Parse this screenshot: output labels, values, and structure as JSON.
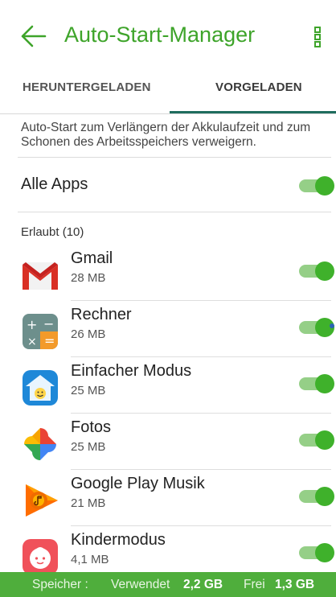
{
  "header": {
    "title": "Auto-Start-Manager"
  },
  "tabs": [
    {
      "label": "HERUNTERGELADEN",
      "selected": false
    },
    {
      "label": "VORGELADEN",
      "selected": true
    }
  ],
  "description": "Auto-Start zum Verlängern der Akkulaufzeit und zum Schonen des Arbeitsspeichers verweigern.",
  "all_apps": {
    "label": "Alle Apps",
    "enabled": true
  },
  "section": {
    "label": "Erlaubt (10)"
  },
  "apps": [
    {
      "name": "Gmail",
      "size": "28 MB",
      "icon": "gmail-icon",
      "enabled": true
    },
    {
      "name": "Rechner",
      "size": "26 MB",
      "icon": "calculator-icon",
      "enabled": true
    },
    {
      "name": "Einfacher Modus",
      "size": "25 MB",
      "icon": "easy-mode-icon",
      "enabled": true
    },
    {
      "name": "Fotos",
      "size": "25 MB",
      "icon": "photos-pinwheel-icon",
      "enabled": true
    },
    {
      "name": "Google Play Musik",
      "size": "21 MB",
      "icon": "play-music-icon",
      "enabled": true
    },
    {
      "name": "Kindermodus",
      "size": "4,1 MB",
      "icon": "kids-mode-icon",
      "enabled": true
    }
  ],
  "footer": {
    "label": "Speicher :",
    "used_label": "Verwendet",
    "used_value": "2,2 GB",
    "free_label": "Frei",
    "free_value": "1,3 GB"
  },
  "colors": {
    "accent": "#3ea42a",
    "toggle_on": "#3fb12b",
    "tab_indicator": "#1f6d5e",
    "footer_bg": "#4fae3c"
  }
}
